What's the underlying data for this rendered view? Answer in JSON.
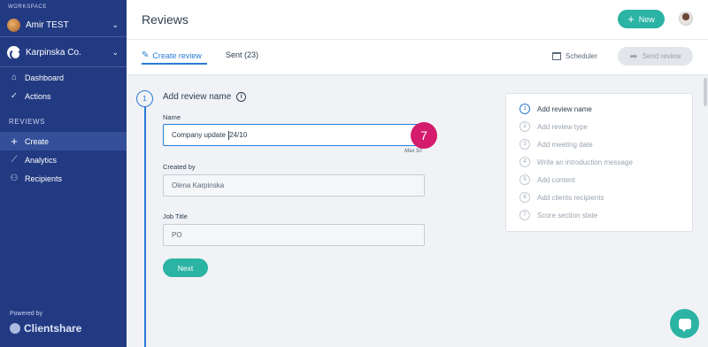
{
  "sidebar": {
    "workspace_label": "WORKSPACE",
    "workspaces": [
      {
        "name": "Amir TEST",
        "chevron": "⌄"
      },
      {
        "name": "Karpinska Co.",
        "chevron": "⌄"
      }
    ],
    "nav_top": [
      {
        "label": "Dashboard",
        "icon": "dashboard-icon"
      },
      {
        "label": "Actions",
        "icon": "actions-icon"
      }
    ],
    "section_label": "REVIEWS",
    "nav_reviews": [
      {
        "label": "Create",
        "icon": "plus-icon",
        "active": true
      },
      {
        "label": "Analytics",
        "icon": "analytics-icon"
      },
      {
        "label": "Recipients",
        "icon": "recipients-icon"
      }
    ],
    "powered_by": "Powered by",
    "brand": "Clientshare"
  },
  "header": {
    "title": "Reviews",
    "new_button": "New"
  },
  "tabs": {
    "create": "Create review",
    "sent": "Sent (23)",
    "scheduler": "Scheduler",
    "send_review": "Send review"
  },
  "form": {
    "step_number": "1",
    "section_title": "Add review name",
    "name_label": "Name",
    "name_value_before_caret": "Company update ",
    "name_value_after_caret": "24/10",
    "counter": "7",
    "max_hint": "Max 50",
    "created_by_label": "Created by",
    "created_by_value": "Olena Karpinska",
    "job_title_label": "Job Title",
    "job_title_value": "PO",
    "next_button": "Next"
  },
  "steps": [
    {
      "num": "1",
      "label": "Add review name",
      "active": true
    },
    {
      "num": "2",
      "label": "Add review type"
    },
    {
      "num": "3",
      "label": "Add meeting date"
    },
    {
      "num": "4",
      "label": "Write an introduction message"
    },
    {
      "num": "5",
      "label": "Add content"
    },
    {
      "num": "6",
      "label": "Add clients recipients"
    },
    {
      "num": "7",
      "label": "Score section state"
    }
  ],
  "colors": {
    "sidebar": "#223a82",
    "accent_teal": "#2bb3a4",
    "accent_blue": "#2a7bd6",
    "counter_badge": "#d41b6c"
  }
}
